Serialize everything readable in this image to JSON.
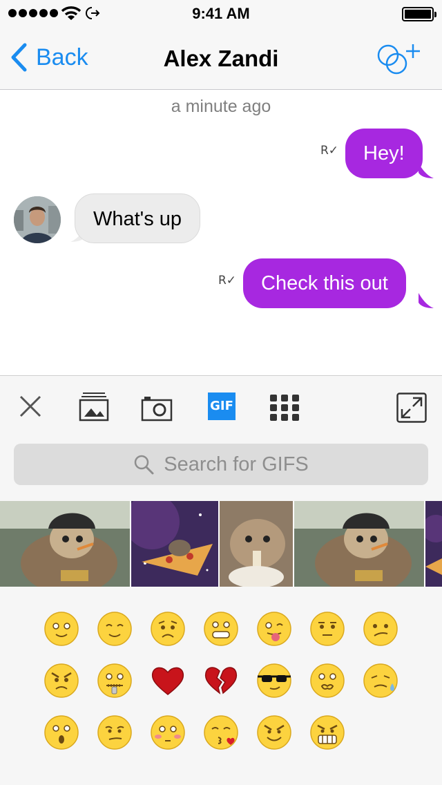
{
  "status_bar": {
    "time": "9:41 AM",
    "signal_bars": 5,
    "battery_level": 1.0
  },
  "nav": {
    "back_label": "Back",
    "title": "Alex Zandi",
    "add_icon": "add-people-icon"
  },
  "chat": {
    "timestamp": "a minute ago",
    "messages": [
      {
        "direction": "sent",
        "text": "Hey!",
        "receipt": "R"
      },
      {
        "direction": "received",
        "text": "What's up"
      },
      {
        "direction": "sent",
        "text": "Check this out",
        "receipt": "R"
      }
    ]
  },
  "toolbar": {
    "items": [
      "close-icon",
      "photos-icon",
      "camera-icon",
      "gif-icon",
      "stickers-grid-icon",
      "expand-icon"
    ],
    "gif_label": "GIF"
  },
  "search": {
    "placeholder": "Search for GIFS"
  },
  "gifs": [
    "sloth-with-cap",
    "sloth-on-pizza-in-space",
    "baby-sloth",
    "sloth-with-cap",
    "sloth-on-pizza-in-space"
  ],
  "emoji": [
    [
      "smile",
      "blush",
      "worried",
      "grin",
      "tongue-wink",
      "neutral",
      "confused"
    ],
    [
      "angry",
      "zipper-mouth",
      "red-heart",
      "broken-heart",
      "sunglasses",
      "cute",
      "sweat"
    ],
    [
      "surprised",
      "smirk",
      "flushed",
      "kiss",
      "sly-grin",
      "grimace"
    ]
  ],
  "colors": {
    "accent": "#1a8cf0",
    "sent_bubble": "#a728e0",
    "received_bubble": "#ececec"
  }
}
